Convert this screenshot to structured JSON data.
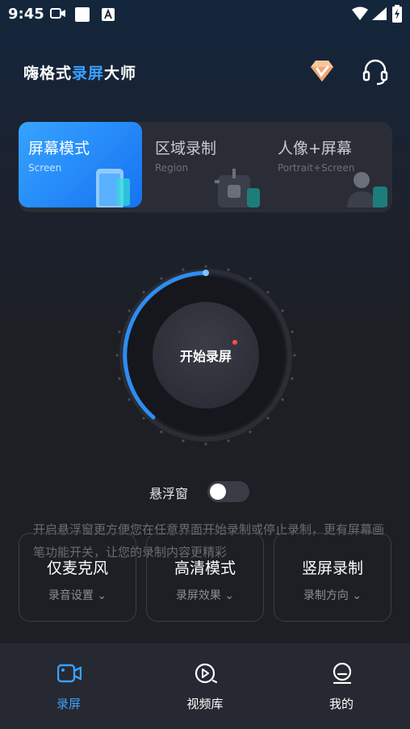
{
  "status_bar": {
    "time": "9:45",
    "icons": [
      "video-icon",
      "square-icon",
      "a-icon",
      "wifi-icon",
      "signal-icon",
      "battery-charging-icon"
    ]
  },
  "header": {
    "title_part1": "嗨格式",
    "title_accent": "录屏",
    "title_part2": "大师",
    "vip_icon": "diamond-icon",
    "service_icon": "headset-icon"
  },
  "modes": [
    {
      "title": "屏幕模式",
      "subtitle": "Screen",
      "active": true
    },
    {
      "title": "区域录制",
      "subtitle": "Region",
      "active": false
    },
    {
      "title": "人像+屏幕",
      "subtitle": "Portrait+Screen",
      "active": false
    }
  ],
  "record": {
    "label": "开始录屏"
  },
  "floating_window": {
    "label": "悬浮窗",
    "enabled": false,
    "description": "开启悬浮窗更方便您在任意界面开始录制或停止录制，更有屏幕画笔功能开关，让您的录制内容更精彩"
  },
  "options": [
    {
      "title": "仅麦克风",
      "subtitle": "录音设置"
    },
    {
      "title": "高清模式",
      "subtitle": "录屏效果"
    },
    {
      "title": "竖屏录制",
      "subtitle": "录制方向"
    }
  ],
  "bottom_nav": [
    {
      "label": "录屏",
      "icon": "video-camera-icon",
      "active": true
    },
    {
      "label": "视频库",
      "icon": "play-circle-icon",
      "active": false
    },
    {
      "label": "我的",
      "icon": "profile-icon",
      "active": false
    }
  ],
  "colors": {
    "accent": "#3aa0ff",
    "background": "#1d1f24",
    "card": "#2a2d35",
    "record_dot": "#ff4d4d"
  }
}
